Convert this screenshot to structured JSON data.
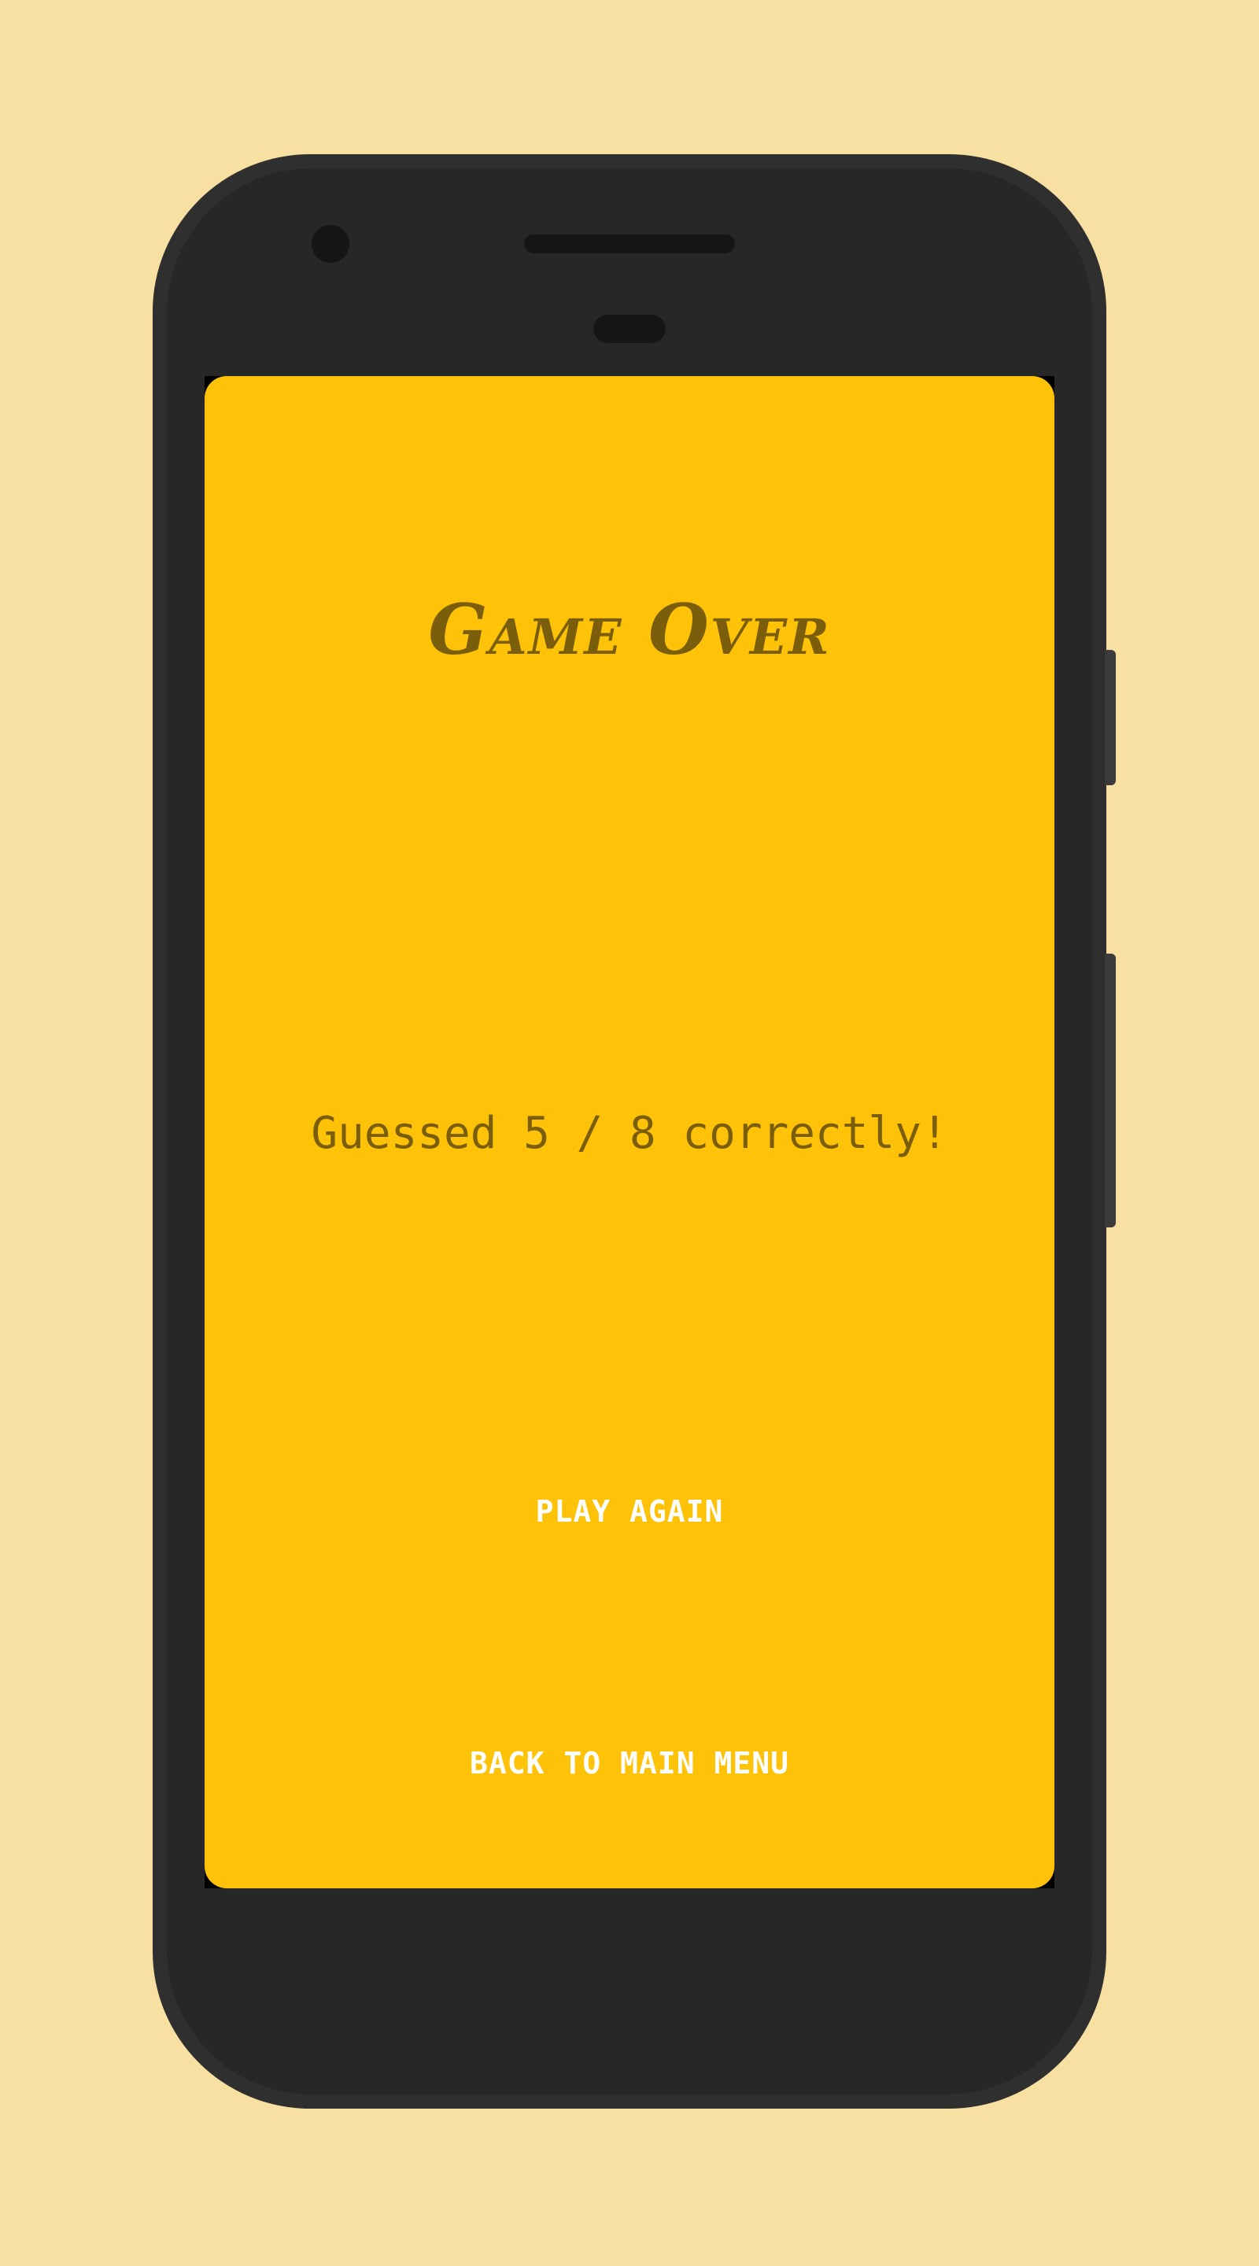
{
  "app": {
    "title": "Game Over"
  },
  "result": {
    "score_text": "Guessed 5 / 8 correctly!"
  },
  "actions": {
    "play_again_label": "PLAY AGAIN",
    "main_menu_label": "BACK TO MAIN MENU"
  },
  "colors": {
    "page_background": "#f7e0a1",
    "screen_background": "#fec208",
    "text_dark": "#7a5e0b",
    "button_text": "#ffffff",
    "phone_body": "#272727"
  }
}
